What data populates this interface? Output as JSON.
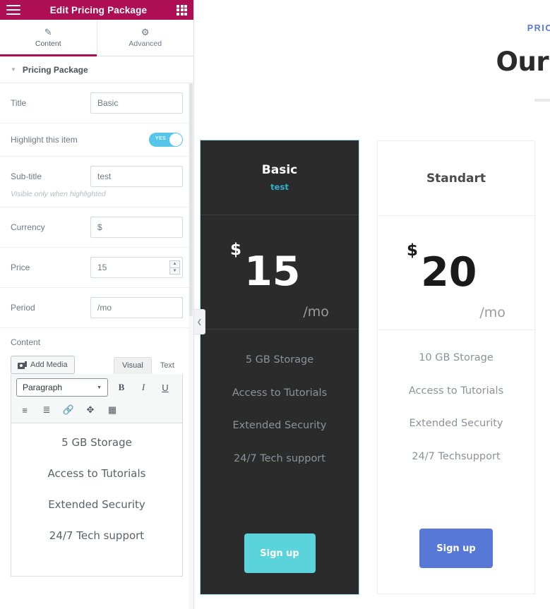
{
  "panel": {
    "header": {
      "title": "Edit Pricing Package",
      "menu_icon": "hamburger-icon",
      "widgets_icon": "grid-icon"
    },
    "tabs": [
      {
        "label": "Content",
        "icon": "pencil-icon",
        "active": true
      },
      {
        "label": "Advanced",
        "icon": "gear-icon",
        "active": false
      }
    ],
    "section": {
      "label": "Pricing Package",
      "caret": "▼"
    },
    "controls": {
      "title": {
        "label": "Title",
        "value": "Basic"
      },
      "highlight": {
        "label": "Highlight this item",
        "state": "YES",
        "on": true
      },
      "subtitle": {
        "label": "Sub-title",
        "value": "test",
        "hint": "Visible only when highlighted"
      },
      "currency": {
        "label": "Currency",
        "value": "$"
      },
      "price": {
        "label": "Price",
        "value": "15"
      },
      "period": {
        "label": "Period",
        "value": "/mo"
      },
      "content": {
        "label": "Content"
      }
    },
    "editor": {
      "add_media": "Add Media",
      "tabs": [
        {
          "label": "Visual",
          "active": true
        },
        {
          "label": "Text",
          "active": false
        }
      ],
      "format_select": "Paragraph",
      "buttons": {
        "bold": "B",
        "italic": "I",
        "underline": "U",
        "bullet_list": "bullet-list-icon",
        "numbered_list": "numbered-list-icon",
        "link": "link-icon",
        "fullscreen": "fullscreen-icon",
        "toolbar_toggle": "toolbar-toggle-icon"
      },
      "lines": [
        "5 GB Storage",
        "Access to Tutorials",
        "Extended Security",
        "24/7 Tech support"
      ]
    },
    "collapse_handle": "chevron-left-icon"
  },
  "preview": {
    "eyebrow": "PRIC",
    "heading": "Our Pac",
    "cards": [
      {
        "id": "basic",
        "theme": "dark",
        "selected": true,
        "title": "Basic",
        "subtitle": "test",
        "currency": "$",
        "price": "15",
        "period": "/mo",
        "features": [
          "5 GB Storage",
          "Access to Tutorials",
          "Extended Security",
          "24/7 Tech support"
        ],
        "button": "Sign up",
        "button_color": "#5ad3da"
      },
      {
        "id": "standart",
        "theme": "light",
        "selected": false,
        "title": "Standart",
        "subtitle": "",
        "currency": "$",
        "price": "20",
        "period": "/mo",
        "features": [
          "10 GB Storage",
          "Access to Tutorials",
          "Extended Security",
          "24/7 Techsupport"
        ],
        "button": "Sign up",
        "button_color": "#5878d8"
      }
    ]
  },
  "colors": {
    "brand_crimson": "#AE0E54",
    "toggle_blue": "#55c5ea",
    "accent_teal": "#2fb4cf",
    "card_dark_bg": "#2b2b2b",
    "eyebrow_blue": "#5878d8"
  }
}
